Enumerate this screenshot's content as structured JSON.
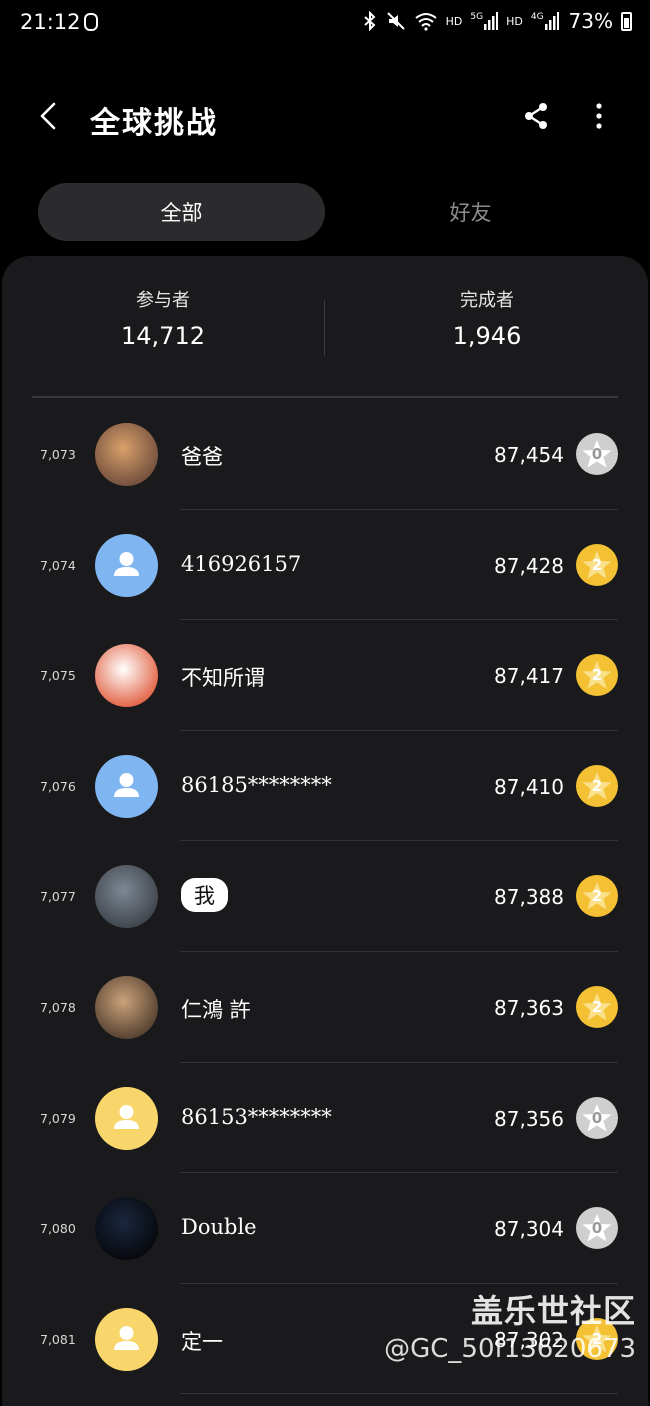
{
  "status_bar": {
    "time": "21:12",
    "battery": "73%",
    "icons": [
      "watch-icon",
      "bluetooth-icon",
      "mute-icon",
      "wifi-icon",
      "signal-5g-icon",
      "signal-4g-icon",
      "battery-icon"
    ],
    "network_labels": [
      "HD",
      "5G",
      "HD",
      "4G"
    ]
  },
  "header": {
    "title": "全球挑战",
    "back_icon": "back-arrow-icon",
    "share_icon": "share-icon",
    "more_icon": "more-vertical-icon"
  },
  "tabs": [
    {
      "label": "全部",
      "selected": true
    },
    {
      "label": "好友",
      "selected": false
    }
  ],
  "stats": {
    "participants": {
      "label": "参与者",
      "value": "14,712"
    },
    "finishers": {
      "label": "完成者",
      "value": "1,946"
    }
  },
  "leaderboard": [
    {
      "rank": "7,073",
      "name": "爸爸",
      "score": "87,454",
      "badge": "0",
      "avatar": "photo"
    },
    {
      "rank": "7,074",
      "name": "416926157",
      "score": "87,428",
      "badge": "2",
      "avatar": "default-blue"
    },
    {
      "rank": "7,075",
      "name": "不知所谓",
      "score": "87,417",
      "badge": "2",
      "avatar": "photo"
    },
    {
      "rank": "7,076",
      "name": "86185********",
      "score": "87,410",
      "badge": "2",
      "avatar": "default-blue"
    },
    {
      "rank": "7,077",
      "name": "我",
      "score": "87,388",
      "badge": "2",
      "avatar": "photo"
    },
    {
      "rank": "7,078",
      "name": "仁鴻 許",
      "score": "87,363",
      "badge": "2",
      "avatar": "photo"
    },
    {
      "rank": "7,079",
      "name": "86153********",
      "score": "87,356",
      "badge": "0",
      "avatar": "default-yellow"
    },
    {
      "rank": "7,080",
      "name": "Double",
      "score": "87,304",
      "badge": "0",
      "avatar": "photo"
    },
    {
      "rank": "7,081",
      "name": "定一",
      "score": "87,302",
      "badge": "2",
      "avatar": "default-yellow"
    }
  ],
  "watermark": {
    "title": "盖乐世社区",
    "handle": "@GC_50f13620673"
  },
  "colors": {
    "background": "#000000",
    "panel": "#1a1a1c",
    "gold_badge": "#f3c133",
    "gray_badge": "#cfcfcf",
    "avatar_blue": "#7fb5f0",
    "avatar_yellow": "#f8d66b"
  }
}
